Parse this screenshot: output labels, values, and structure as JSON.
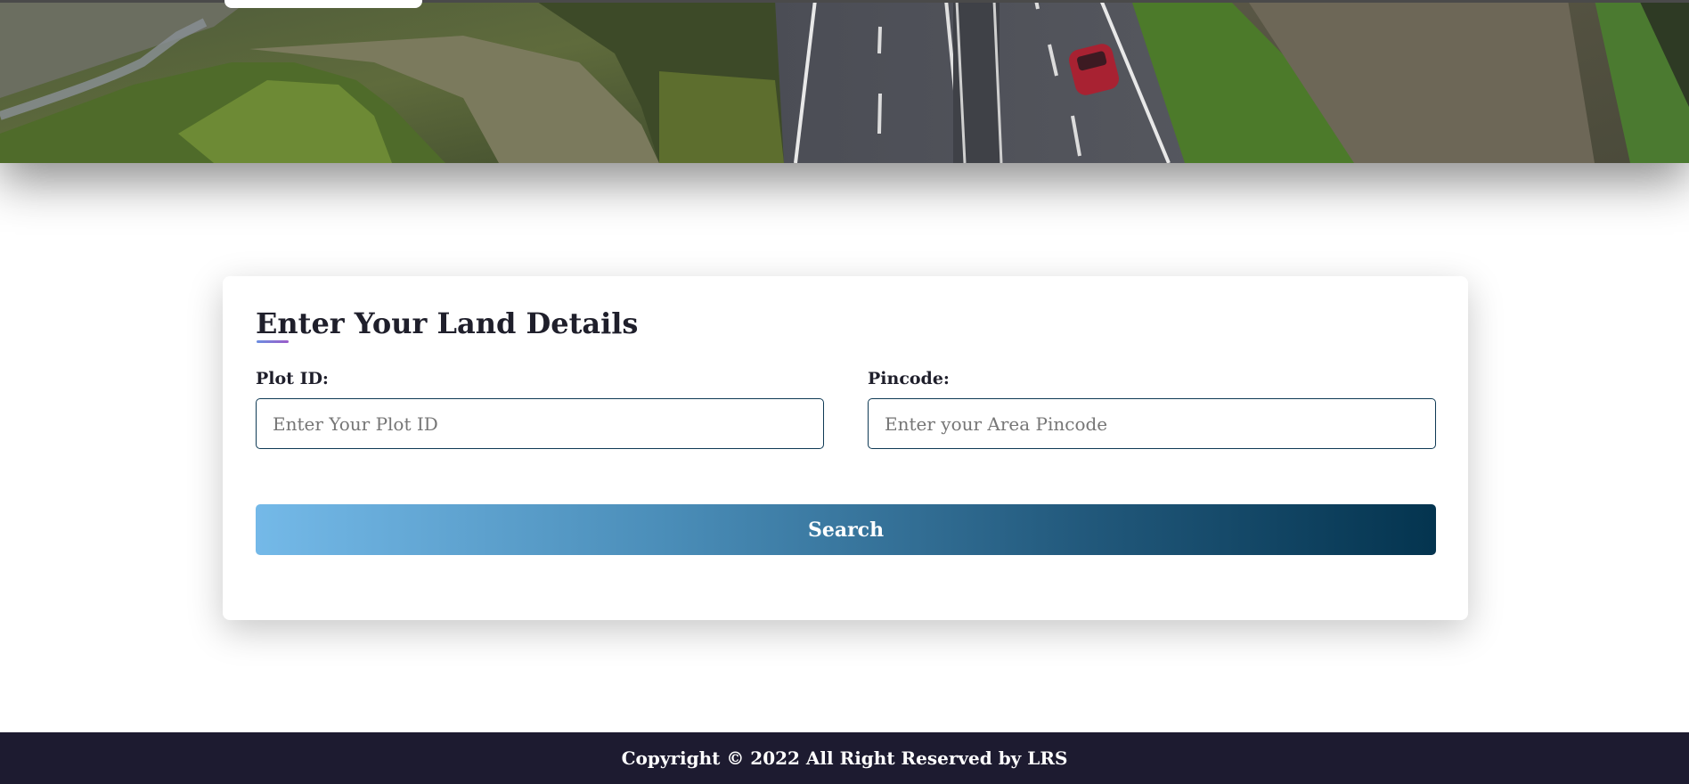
{
  "hero": {
    "image": "aerial-highway-fields-image"
  },
  "form": {
    "title": "Enter Your Land Details",
    "plot_id": {
      "label": "Plot ID:",
      "placeholder": "Enter Your Plot ID",
      "value": ""
    },
    "pincode": {
      "label": "Pincode:",
      "placeholder": "Enter your Area Pincode",
      "value": ""
    },
    "search_label": "Search"
  },
  "footer": {
    "copyright": "Copyright © 2022 All Right Reserved by LRS"
  },
  "colors": {
    "input_border": "#0f3a55",
    "button_gradient_start": "#74b9e8",
    "button_gradient_end": "#04344f",
    "footer_bg": "#1d1b30",
    "title_accent_start": "#6c8ee0",
    "title_accent_end": "#9b5cc9"
  }
}
